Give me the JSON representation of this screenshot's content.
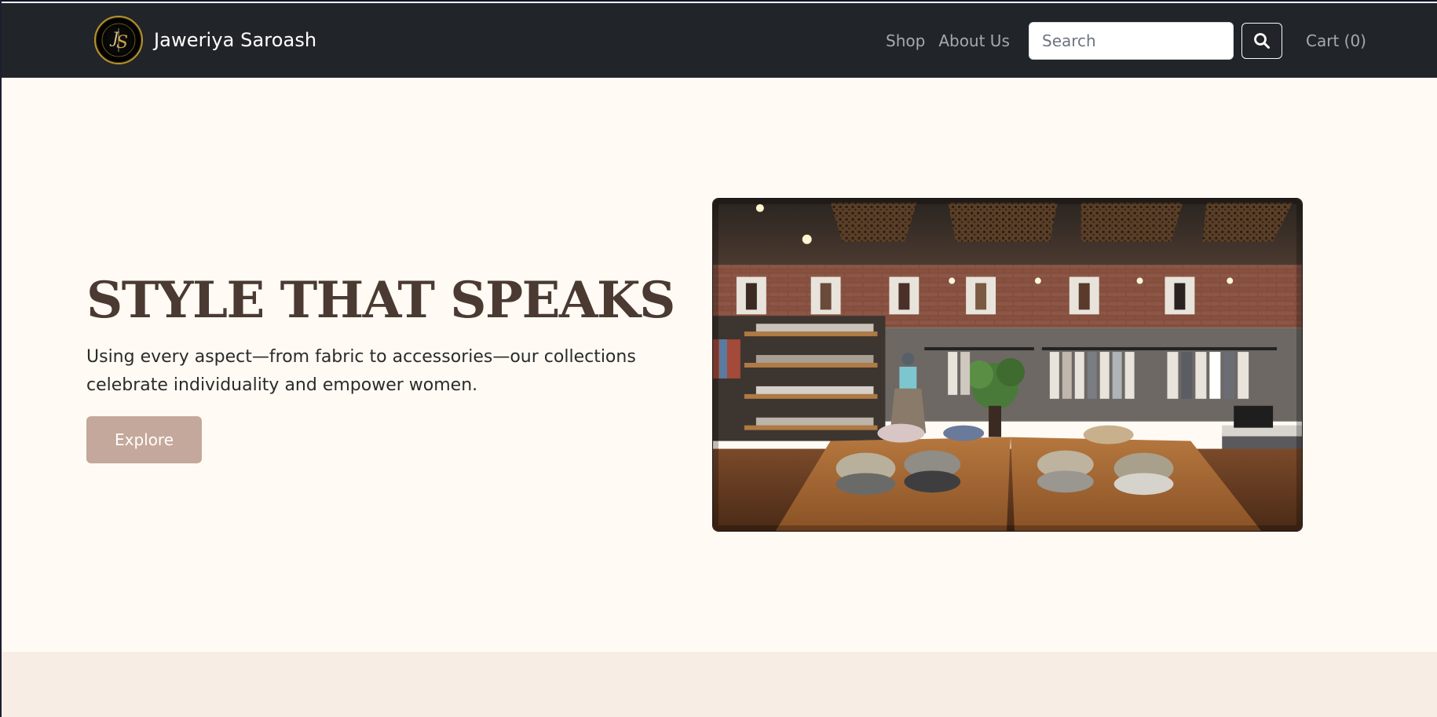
{
  "nav": {
    "brand_name": "Jaweriya Saroash",
    "logo_monogram": "JS",
    "links": [
      {
        "label": "Shop"
      },
      {
        "label": "About Us"
      }
    ],
    "search_placeholder": "Search",
    "cart_label": "Cart (0)"
  },
  "hero": {
    "title": "STYLE THAT SPEAKS",
    "text_line1": "Using every aspect—from fabric to accessories—our collections",
    "text_line2": "celebrate individuality and empower women.",
    "button_label": "Explore",
    "image_alt": "Clothing boutique interior with racks, shelves and folded garments on tables"
  },
  "colors": {
    "navbar": "#212529",
    "hero_bg": "#fffaf4",
    "title": "#4a3a31",
    "button": "#c4a89b",
    "next_section_bg": "#f7ede4",
    "logo_gold": "#b8912e"
  },
  "icons": {
    "search": "search-icon",
    "logo": "js-monogram-logo"
  }
}
